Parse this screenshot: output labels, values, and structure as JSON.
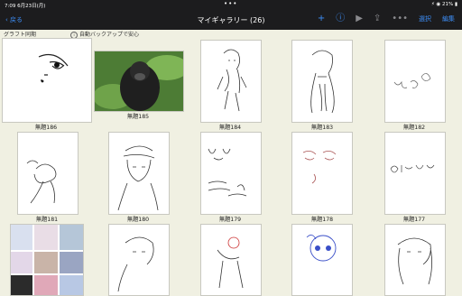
{
  "status": {
    "time": "7:09",
    "date": "6月23日(月)",
    "dots": "•••",
    "right": "⚡ ◉ 21% ▮"
  },
  "nav": {
    "back": "‹ 戻る",
    "title": "マイギャラリー (26)",
    "select": "選択",
    "edit": "編集"
  },
  "subbar": {
    "left": "グラフト同期",
    "right": "自動バックアップで安心"
  },
  "items": [
    {
      "label": "無題186"
    },
    {
      "label": "無題185"
    },
    {
      "label": "無題184"
    },
    {
      "label": "無題183"
    },
    {
      "label": "無題182"
    },
    {
      "label": "無題181"
    },
    {
      "label": "無題180"
    },
    {
      "label": "無題179"
    },
    {
      "label": "無題178"
    },
    {
      "label": "無題177"
    },
    {
      "label": ""
    },
    {
      "label": ""
    },
    {
      "label": ""
    },
    {
      "label": ""
    },
    {
      "label": ""
    }
  ],
  "colors": {
    "accent": "#3d8ef7",
    "bar": "#1c1c1e",
    "bg": "#f0f0e2"
  }
}
